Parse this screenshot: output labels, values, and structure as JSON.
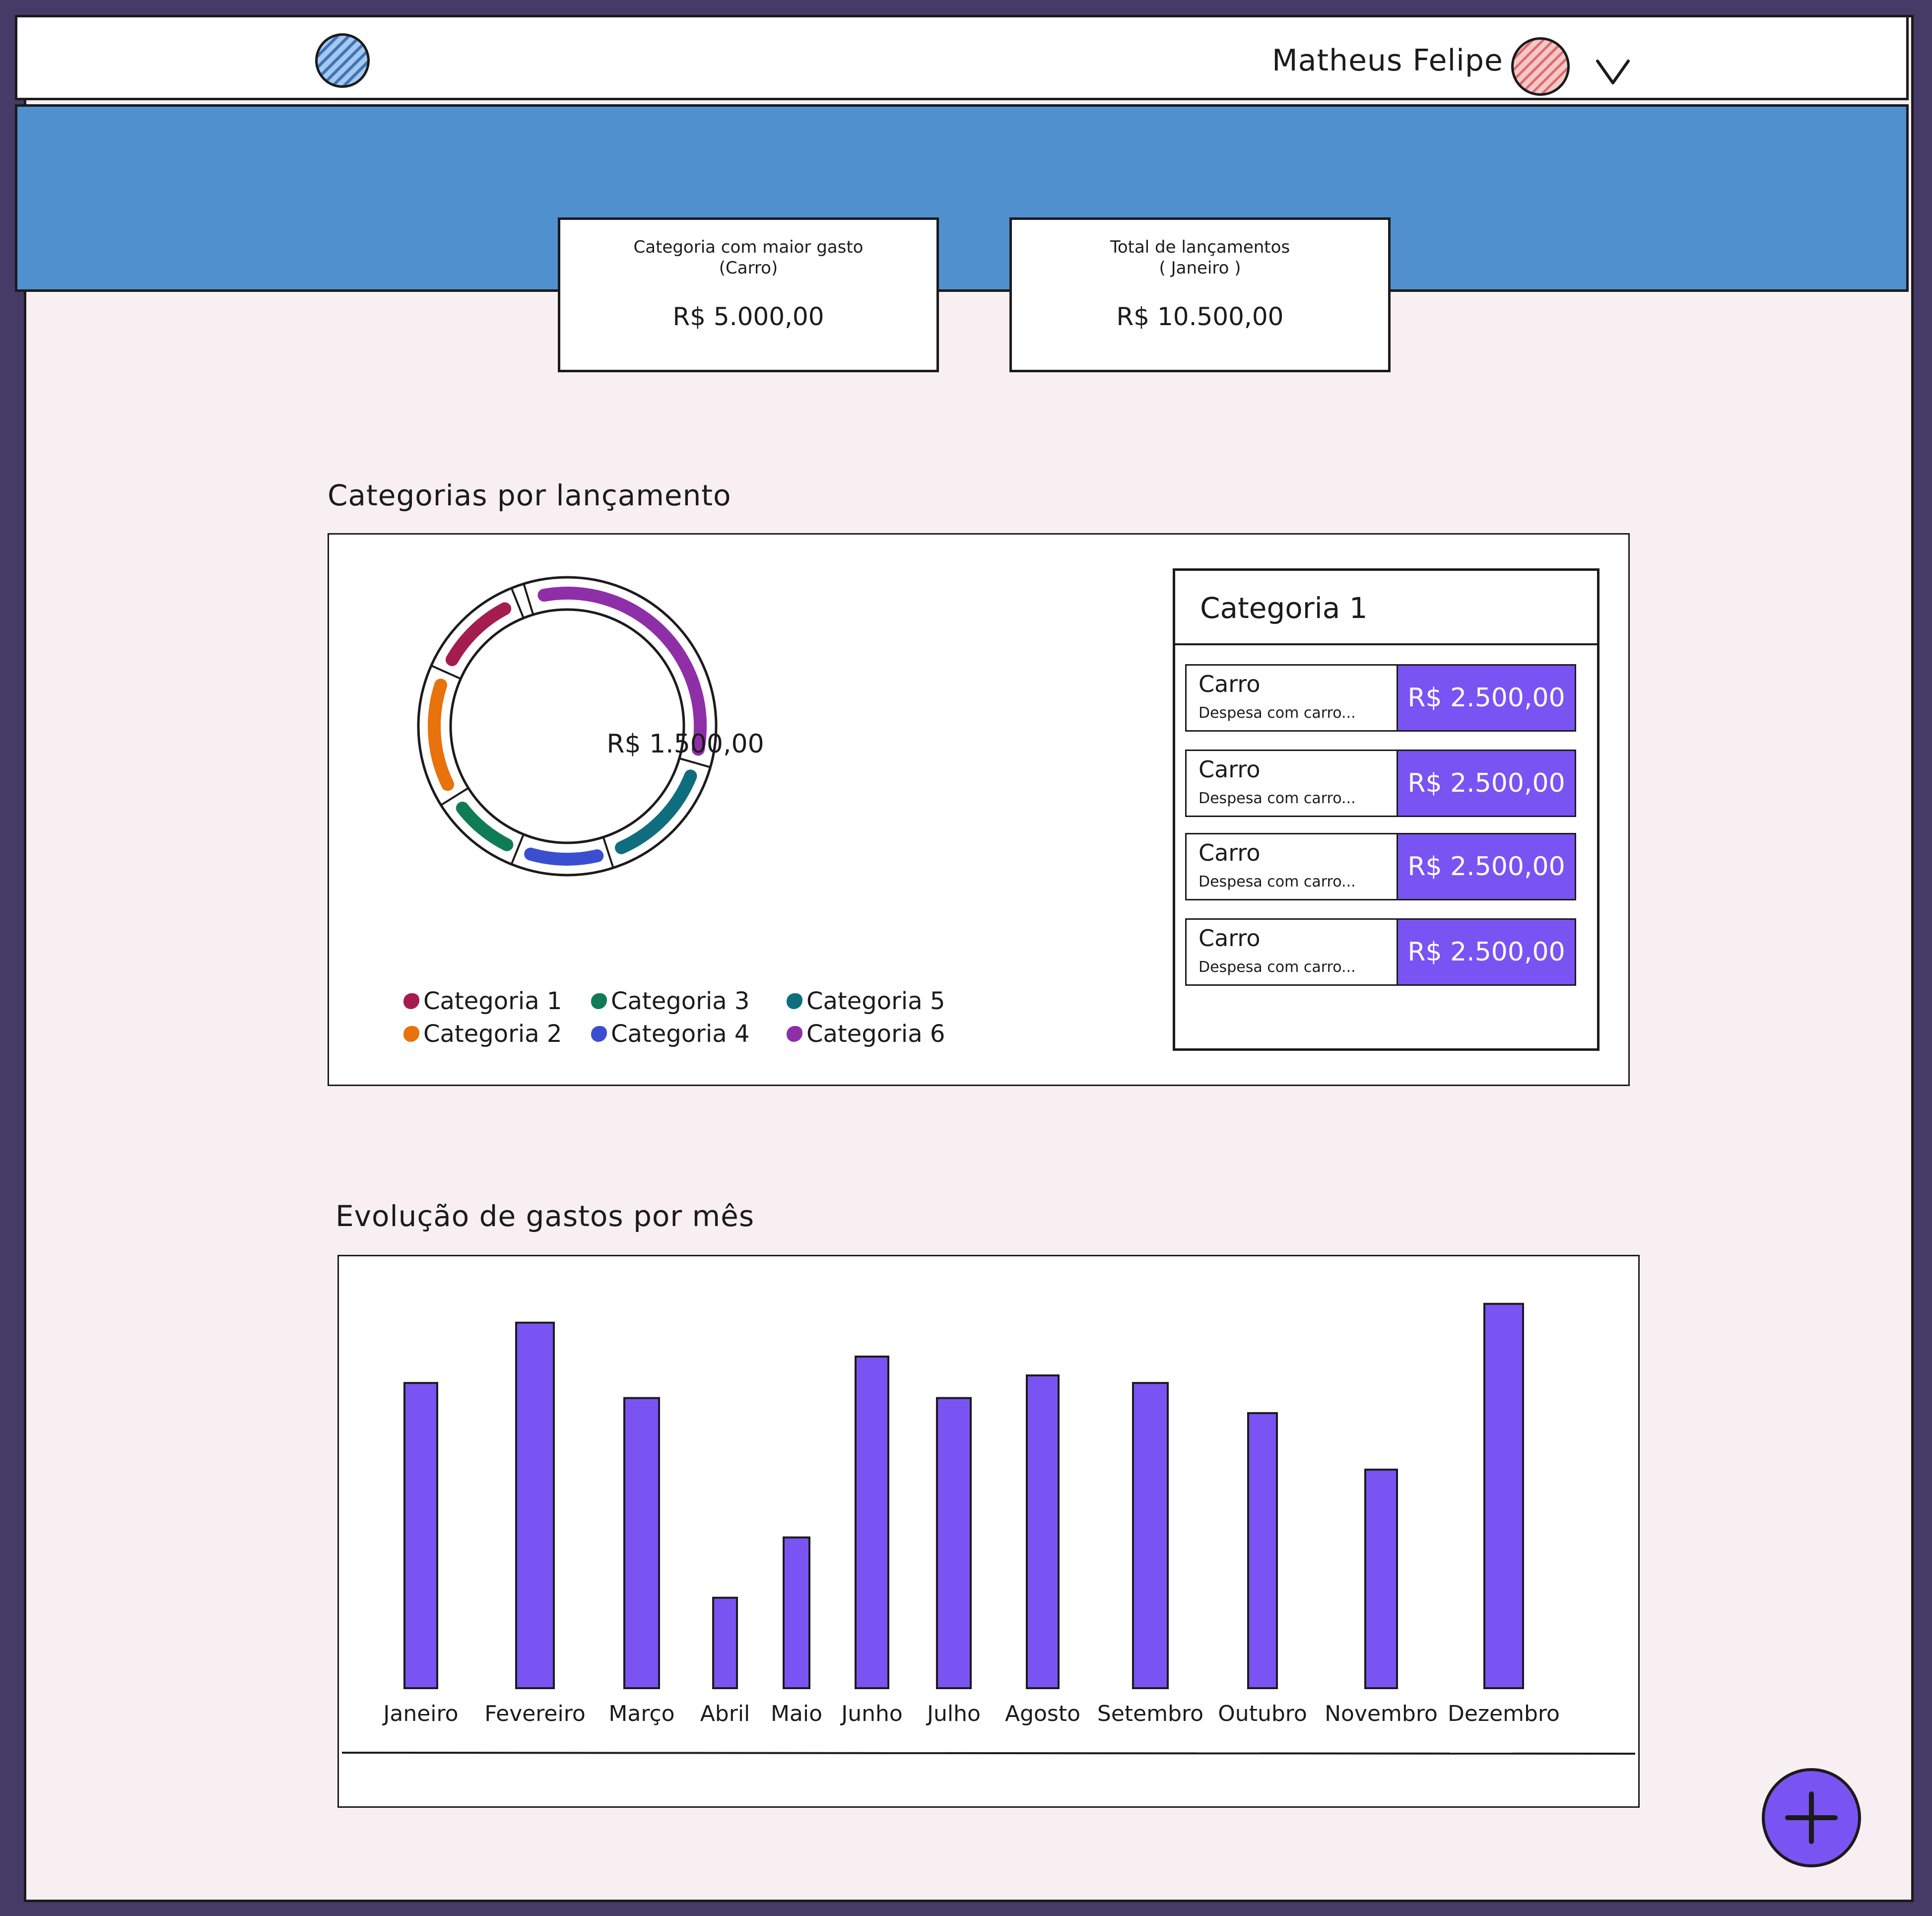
{
  "header": {
    "user_name": "Matheus Felipe",
    "logo_icon": "logo-circle-icon",
    "avatar_icon": "avatar-circle-icon",
    "menu_icon": "chevron-down-icon"
  },
  "stats": [
    {
      "title_line1": "Categoria com maior gasto",
      "title_line2": "(Carro)",
      "value": "R$ 5.000,00"
    },
    {
      "title_line1": "Total de lançamentos",
      "title_line2": "( Janeiro )",
      "value": "R$ 10.500,00"
    }
  ],
  "sections": {
    "categories_title": "Categorias por lançamento",
    "evolution_title": "Evolução de gastos por mês"
  },
  "donut": {
    "center_value": "R$ 1.500,00",
    "segments": [
      {
        "label": "Categoria 1",
        "color": "#a51d4f"
      },
      {
        "label": "Categoria 2",
        "color": "#e8720c"
      },
      {
        "label": "Categoria 3",
        "color": "#107c55"
      },
      {
        "label": "Categoria 4",
        "color": "#3a4fd0"
      },
      {
        "label": "Categoria 5",
        "color": "#0f6e7e"
      },
      {
        "label": "Categoria 6",
        "color": "#8e2fa8"
      }
    ]
  },
  "category_list": {
    "title": "Categoria 1",
    "items": [
      {
        "name": "Carro",
        "description": "Despesa com carro...",
        "amount": "R$ 2.500,00"
      },
      {
        "name": "Carro",
        "description": "Despesa com carro...",
        "amount": "R$ 2.500,00"
      },
      {
        "name": "Carro",
        "description": "Despesa com carro...",
        "amount": "R$ 2.500,00"
      },
      {
        "name": "Carro",
        "description": "Despesa com carro...",
        "amount": "R$ 2.500,00"
      }
    ]
  },
  "chart_data": {
    "type": "bar",
    "title": "Evolução de gastos por mês",
    "categories": [
      "Janeiro",
      "Fevereiro",
      "Março",
      "Abril",
      "Maio",
      "Junho",
      "Julho",
      "Agosto",
      "Setembro",
      "Outubro",
      "Novembro",
      "Dezembro"
    ],
    "values": [
      81,
      97,
      77,
      24,
      40,
      88,
      77,
      83,
      81,
      73,
      58,
      102
    ],
    "ylim": [
      0,
      110
    ],
    "color": "#7954f3",
    "grid": false,
    "legend": "none"
  },
  "fab": {
    "icon": "plus-icon",
    "color": "#7954f3"
  }
}
